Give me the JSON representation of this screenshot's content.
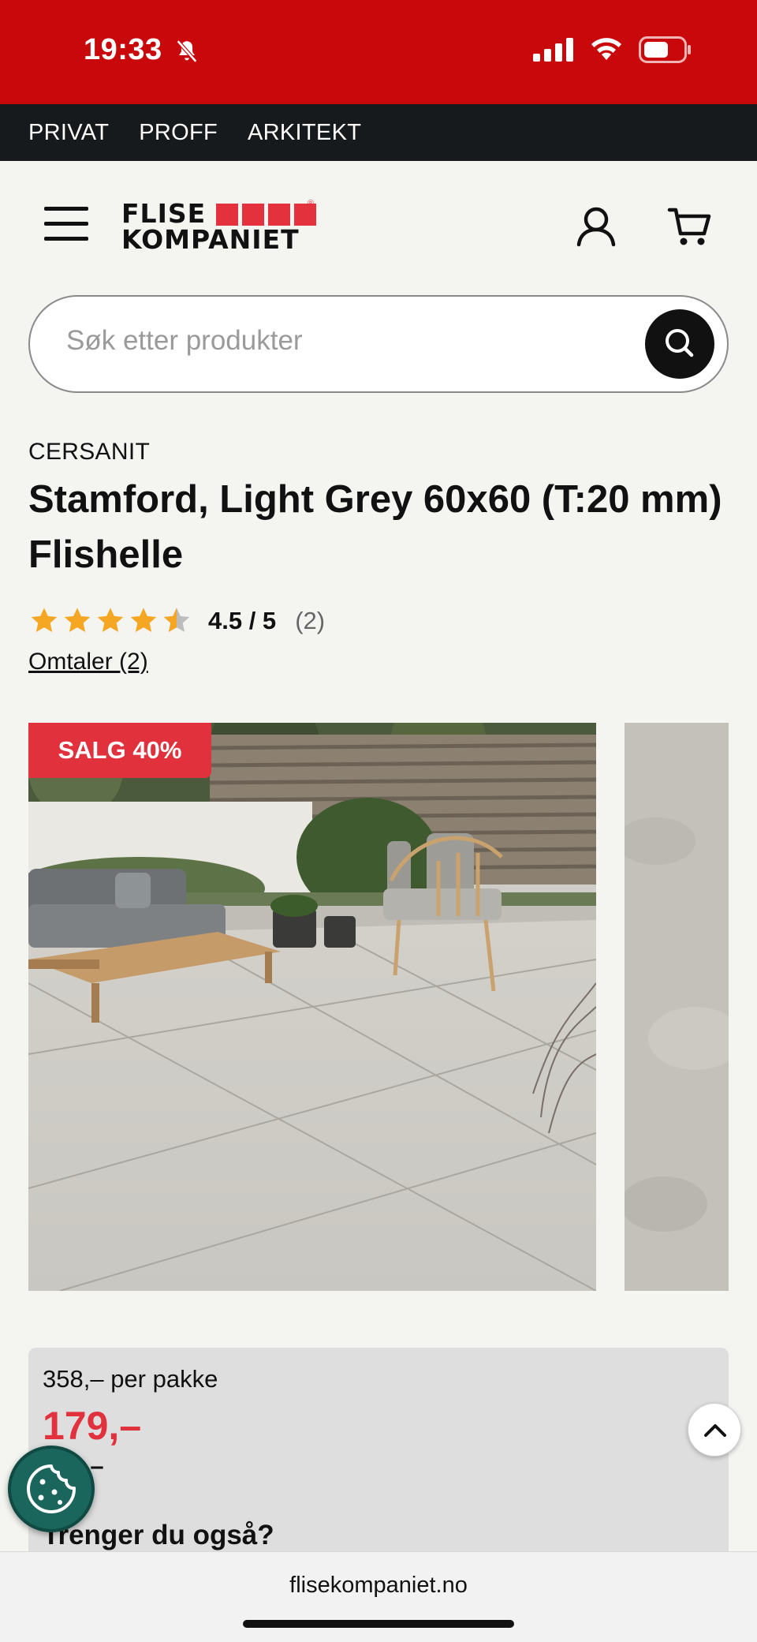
{
  "status_bar": {
    "time": "19:33",
    "icons": [
      "bell-slash-icon",
      "cellular-signal-icon",
      "wifi-icon",
      "battery-icon"
    ]
  },
  "audience_nav": {
    "items": [
      "PRIVAT",
      "PROFF",
      "ARKITEKT"
    ]
  },
  "header": {
    "logo_line1": "FLISE",
    "logo_line2": "KOMPANIET",
    "logo_mark": "®",
    "icons": [
      "menu-icon",
      "user-icon",
      "cart-icon"
    ]
  },
  "search": {
    "placeholder": "Søk etter produkter",
    "value": ""
  },
  "product": {
    "brand": "CERSANIT",
    "title": "Stamford, Light Grey 60x60 (T:20 mm) Flishelle",
    "rating_fraction": 0.9,
    "rating_value": "4.5 / 5",
    "rating_count": "(2)",
    "reviews_link": "Omtaler (2)",
    "sale_badge": "SALG 40%",
    "unit_price": "358,– per pakke",
    "sale_price": "179,–",
    "old_price": "299,–",
    "also_need": "Trenger du også?"
  },
  "browser": {
    "url": "flisekompaniet.no"
  },
  "colors": {
    "status_red": "#c8080b",
    "brand_red": "#e0313d",
    "dark": "#171a1c",
    "star": "#f5a623",
    "cookie_green": "#1a665c"
  }
}
